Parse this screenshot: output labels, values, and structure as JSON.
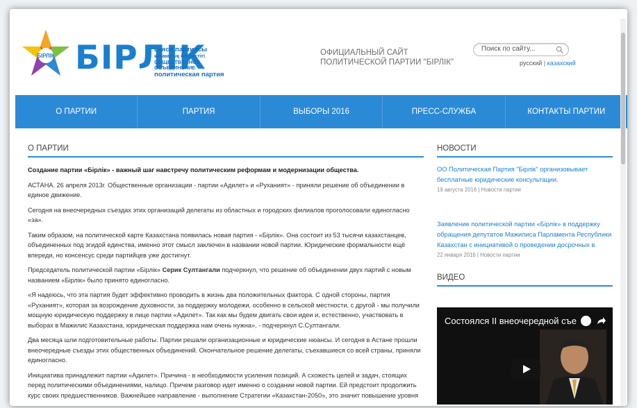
{
  "header": {
    "logo": {
      "word": "БІРЛІК",
      "sub_lines": [
        "саяси партиясы",
        "қоғамдық бірлестігі",
        "ОБЩЕСТВЕННОЕ ОБЪЕДИНЕНИЕ",
        "политическая партия"
      ]
    },
    "site_title_line1": "ОФИЦИАЛЬНЫЙ САЙТ",
    "site_title_line2": "ПОЛИТИЧЕСКОЙ ПАРТИИ \"БІРЛІК\"",
    "search_placeholder": "Поиск по сайту...",
    "lang_current": "русский",
    "lang_separator": "|",
    "lang_other": "казахский"
  },
  "nav": [
    "О ПАРТИИ",
    "ПАРТИЯ",
    "ВЫБОРЫ 2016",
    "ПРЕСС-СЛУЖБА",
    "КОНТАКТЫ ПАРТИИ"
  ],
  "main": {
    "section_title": "О ПАРТИИ",
    "lead": "Создание партии «Бірлік» - важный шаг навстречу политическим реформам и модернизации общества.",
    "paragraphs": [
      "АСТАНА. 26 апреля 2013г. Общественные организации - партии «Адилет» и «Руханият» - приняли решение об объединении в единое движение.",
      "Сегодня на внеочередных съездах этих организаций делегаты из областных и городских филиалов проголосовали единогласно «за».",
      "Таким образом, на политической карте Казахстана появилась новая партия - «Бірлік». Она состоит из 53 тысячи казахстанцев, объединенных под эгидой единства, именно этот смысл заключен в названии новой партии. Юридические формальности ещё впереди, но консенсус среди партийцев уже достигнут."
    ],
    "p4_before": "Председатель политической партии «Бірлік» ",
    "p4_bold": "Серик Султангали",
    "p4_after": " подчеркнул, что решение об объединении двух партий с новым названием «Бірлік» было принято единогласно.",
    "paragraphs2": [
      "«Я надеюсь, что эта партия будет эффективно проводить в жизнь два положительных фактора. С одной стороны, партия «Руханият», которая за возрождение духовности, за поддержку молодежи, особенно в сельской местности, с другой - мы получили мощную юридическую поддержку в лице партии «Адилет». Так как мы будем двигать свои идеи и,  естественно, участвовать в выборах в Мажилис Казахстана, юридическая поддержка нам очень нужна», - подчеркнул С.Султангали.",
      "Два месяца шли подготовительные работы. Партии решали организационные и юридические нюансы. И сегодня в Астане прошли внеочередные съезды этих общественных объединений. Окончательное решение делегаты, съехавшиеся со всей страны, приняли единогласно.",
      "Инициатива принадлежит партии «Адилет».  Причина - в необходимости усиления позиций. А схожесть целей и задач, стоящих перед политическими объединениями, налицо. Причем разговор идет именно о создании новой партии. Ей предстоит продолжить курс своих предшественников. Важнейшее направление - выполнение Стратегии «Казахстан-2050», это значит повышение уровня"
    ]
  },
  "sidebar": {
    "news_title": "НОВОСТИ",
    "news": [
      {
        "title": "ОО Политическая Партия \"Бірлік\" организовывает бесплатные юридические консультации.",
        "meta": "19 августа 2016 | Новости партии"
      },
      {
        "title": "Заявление политической партии «Бірлік» в поддержку обращения депутатов Мажилиса Парламента Республики Казахстан с инициативой о проведении досрочных в",
        "meta": "22 января 2016 | Новости партии"
      }
    ],
    "video_title": "ВИДЕО",
    "video_caption": "Состоялся II внеочередной съез..."
  },
  "colors": {
    "accent": "#2b8ad6",
    "link": "#1a7fcf"
  }
}
